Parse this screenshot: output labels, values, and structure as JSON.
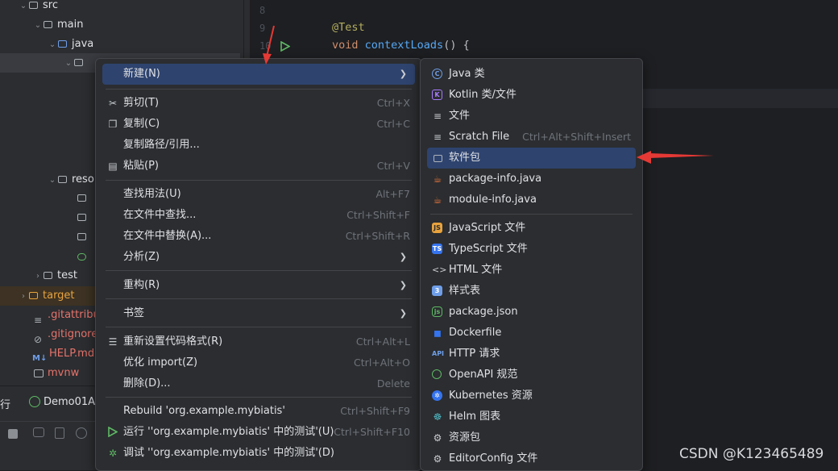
{
  "tree": {
    "items": [
      {
        "label": "src"
      },
      {
        "label": "main"
      },
      {
        "label": "java"
      },
      {
        "label": "reso"
      },
      {
        "label": "test"
      },
      {
        "label": "target"
      },
      {
        "label": ".gitattribut"
      },
      {
        "label": ".gitignore"
      },
      {
        "label": "HELP.md"
      },
      {
        "label": "mvnw"
      }
    ]
  },
  "editor": {
    "line_numbers": [
      "8",
      "9",
      "10"
    ],
    "annotation": "@Test",
    "code_void": "void ",
    "code_method": "contextLoads",
    "code_rest": "() {"
  },
  "run_panel": {
    "tab_fragment": "行",
    "config_name": "Demo01Ap"
  },
  "context_menu": {
    "items": [
      {
        "label": "新建(N)",
        "shortcut": ""
      },
      {
        "label": "剪切(T)",
        "shortcut": "Ctrl+X"
      },
      {
        "label": "复制(C)",
        "shortcut": "Ctrl+C"
      },
      {
        "label": "复制路径/引用...",
        "shortcut": ""
      },
      {
        "label": "粘贴(P)",
        "shortcut": "Ctrl+V"
      },
      {
        "label": "查找用法(U)",
        "shortcut": "Alt+F7"
      },
      {
        "label": "在文件中查找...",
        "shortcut": "Ctrl+Shift+F"
      },
      {
        "label": "在文件中替换(A)...",
        "shortcut": "Ctrl+Shift+R"
      },
      {
        "label": "分析(Z)",
        "shortcut": ""
      },
      {
        "label": "重构(R)",
        "shortcut": ""
      },
      {
        "label": "书签",
        "shortcut": ""
      },
      {
        "label": "重新设置代码格式(R)",
        "shortcut": "Ctrl+Alt+L"
      },
      {
        "label": "优化 import(Z)",
        "shortcut": "Ctrl+Alt+O"
      },
      {
        "label": "删除(D)...",
        "shortcut": "Delete"
      },
      {
        "label": "Rebuild 'org.example.mybiatis'",
        "shortcut": "Ctrl+Shift+F9"
      },
      {
        "label": "运行 ''org.example.mybiatis' 中的测试'(U)",
        "shortcut": "Ctrl+Shift+F10"
      },
      {
        "label": "调试 ''org.example.mybiatis' 中的测试'(D)",
        "shortcut": ""
      }
    ]
  },
  "new_submenu": {
    "items": [
      {
        "label": "Java 类",
        "shortcut": "",
        "icon": "java-class-icon"
      },
      {
        "label": "Kotlin 类/文件",
        "shortcut": "",
        "icon": "kotlin-icon"
      },
      {
        "label": "文件",
        "shortcut": "",
        "icon": "file-icon"
      },
      {
        "label": "Scratch File",
        "shortcut": "Ctrl+Alt+Shift+Insert",
        "icon": "scratch-file-icon"
      },
      {
        "label": "软件包",
        "shortcut": "",
        "icon": "package-icon"
      },
      {
        "label": "package-info.java",
        "shortcut": "",
        "icon": "package-info-icon"
      },
      {
        "label": "module-info.java",
        "shortcut": "",
        "icon": "module-info-icon"
      },
      {
        "label": "JavaScript 文件",
        "shortcut": "",
        "icon": "javascript-icon"
      },
      {
        "label": "TypeScript 文件",
        "shortcut": "",
        "icon": "typescript-icon"
      },
      {
        "label": "HTML 文件",
        "shortcut": "",
        "icon": "html-icon"
      },
      {
        "label": "样式表",
        "shortcut": "",
        "icon": "css-icon"
      },
      {
        "label": "package.json",
        "shortcut": "",
        "icon": "nodejs-icon"
      },
      {
        "label": "Dockerfile",
        "shortcut": "",
        "icon": "docker-icon"
      },
      {
        "label": "HTTP 请求",
        "shortcut": "",
        "icon": "api-icon"
      },
      {
        "label": "OpenAPI 规范",
        "shortcut": "",
        "icon": "openapi-icon"
      },
      {
        "label": "Kubernetes 资源",
        "shortcut": "",
        "icon": "kubernetes-icon"
      },
      {
        "label": "Helm 图表",
        "shortcut": "",
        "icon": "helm-icon"
      },
      {
        "label": "资源包",
        "shortcut": "",
        "icon": "resource-bundle-icon"
      },
      {
        "label": "EditorConfig 文件",
        "shortcut": "",
        "icon": "editorconfig-icon"
      }
    ]
  },
  "watermark": "CSDN @K123465489",
  "colors": {
    "highlight": "#2e436e",
    "arrow": "#e53935",
    "accent": "#3574f0"
  }
}
